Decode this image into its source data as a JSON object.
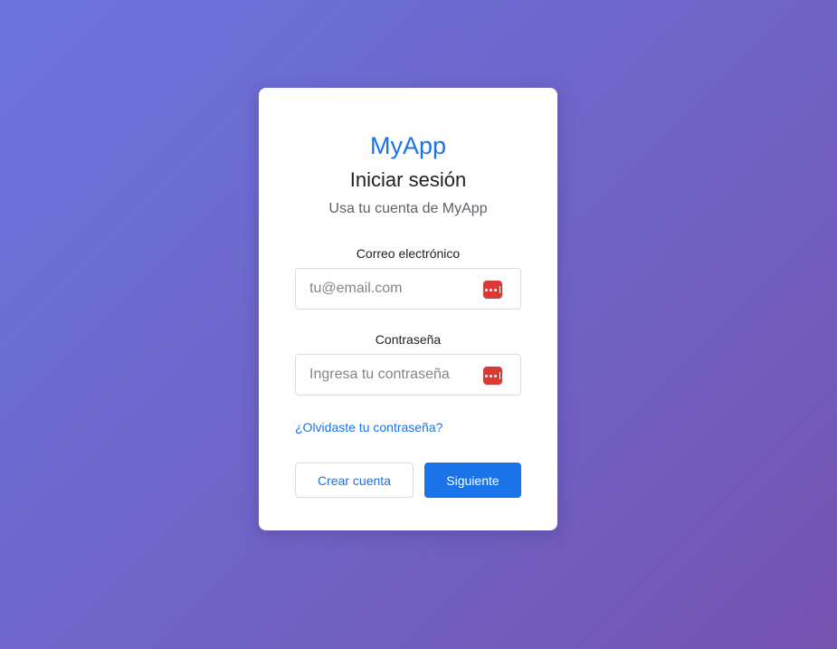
{
  "login": {
    "brand": "MyApp",
    "title": "Iniciar sesión",
    "subtitle": "Usa tu cuenta de MyApp",
    "email": {
      "label": "Correo electrónico",
      "placeholder": "tu@email.com",
      "value": ""
    },
    "password": {
      "label": "Contraseña",
      "placeholder": "Ingresa tu contraseña",
      "value": ""
    },
    "forgot_link": "¿Olvidaste tu contraseña?",
    "create_account_label": "Crear cuenta",
    "next_label": "Siguiente"
  },
  "icons": {
    "password_manager": "password-manager-icon"
  },
  "colors": {
    "accent": "#1a73e8",
    "password_manager_icon": "#d93a35",
    "background_start": "#6b74dc",
    "background_end": "#7553b0"
  }
}
